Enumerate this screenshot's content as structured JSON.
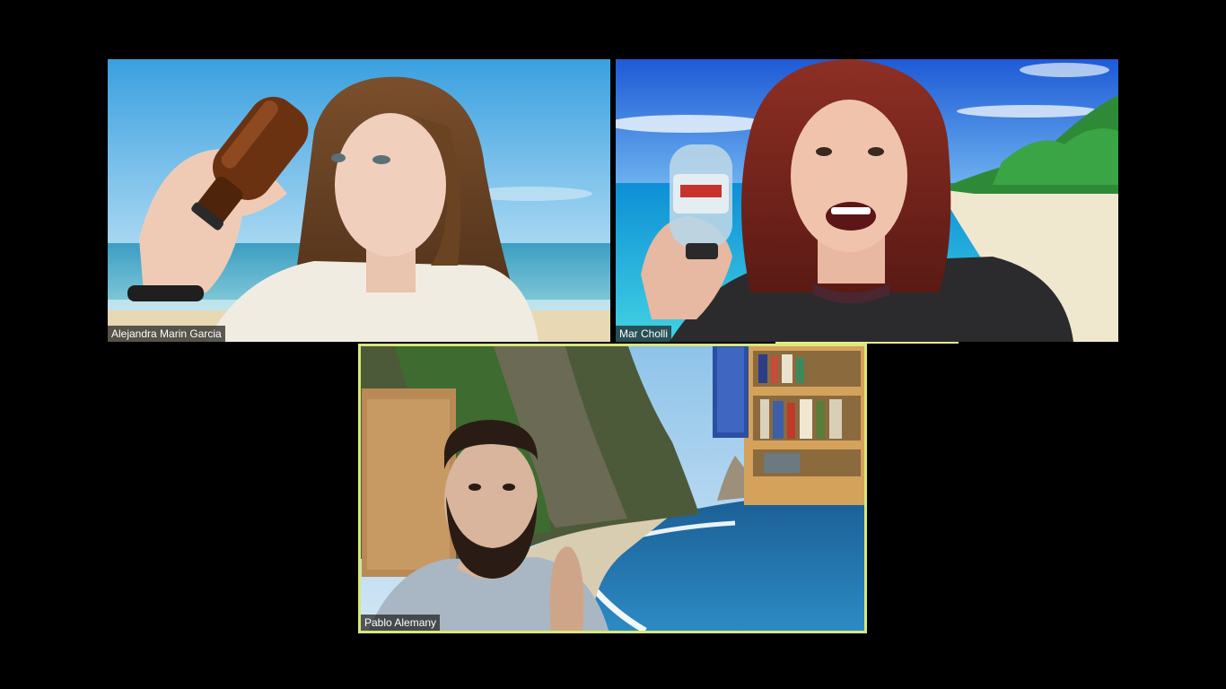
{
  "meeting": {
    "participants": [
      {
        "name": "Alejandra Marin Garcia"
      },
      {
        "name": "Mar Cholli"
      },
      {
        "name": "Pablo Alemany"
      }
    ],
    "active_speaker": "Pablo Alemany"
  },
  "colors": {
    "background": "#000000",
    "active_speaker_border": "#d9e87a",
    "name_label_bg": "#1e1e1e",
    "name_label_text": "#ffffff"
  }
}
